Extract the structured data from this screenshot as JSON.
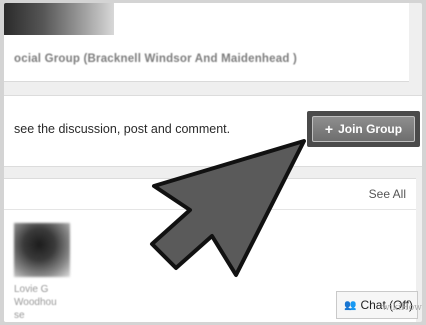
{
  "group": {
    "name": "ocial Group (Bracknell Windsor And Maidenhead )"
  },
  "join": {
    "prompt": "see the discussion, post and comment.",
    "button_label": "Join Group",
    "button_icon": "plus-icon"
  },
  "members": {
    "see_all_label": "See All",
    "items": [
      {
        "name_line1": "Lovie G",
        "name_line2": "Woodhou",
        "name_line3": "se"
      }
    ]
  },
  "chat": {
    "label": "Chat (Off)",
    "icon": "people-icon"
  },
  "watermark": "wikiHow",
  "colors": {
    "page_bg": "#efefef",
    "card_bg": "#ffffff",
    "button_bg": "#7a7a7a",
    "arrow_fill": "#5a5a5a"
  }
}
